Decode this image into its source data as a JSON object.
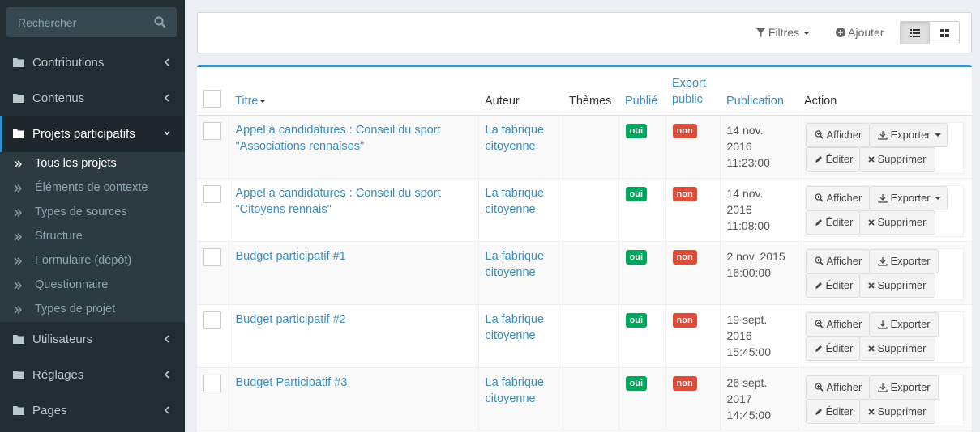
{
  "search": {
    "placeholder": "Rechercher"
  },
  "sidebar": {
    "items": [
      {
        "label": "Contributions"
      },
      {
        "label": "Contenus"
      },
      {
        "label": "Projets participatifs"
      },
      {
        "label": "Utilisateurs"
      },
      {
        "label": "Réglages"
      },
      {
        "label": "Pages"
      }
    ],
    "subitems": [
      {
        "label": "Tous les projets"
      },
      {
        "label": "Éléments de contexte"
      },
      {
        "label": "Types de sources"
      },
      {
        "label": "Structure"
      },
      {
        "label": "Formulaire (dépôt)"
      },
      {
        "label": "Questionnaire"
      },
      {
        "label": "Types de projet"
      }
    ]
  },
  "toolbar": {
    "filters": "Filtres",
    "add": "Ajouter"
  },
  "table": {
    "headers": {
      "title": "Titre",
      "author": "Auteur",
      "themes": "Thèmes",
      "published": "Publié",
      "export_line1": "Export",
      "export_line2": "public",
      "publication": "Publication",
      "action": "Action"
    },
    "actions": {
      "view": "Afficher",
      "export": "Exporter",
      "edit": "Éditer",
      "delete": "Supprimer"
    },
    "rows": [
      {
        "title_line1": "Appel à candidatures : Conseil du sport",
        "title_line2": "\"Associations rennaises\"",
        "author_line1": "La fabrique",
        "author_line2": "citoyenne",
        "published": "oui",
        "export": "non",
        "date_line1": "14 nov.",
        "date_line2": "2016",
        "date_line3": "11:23:00"
      },
      {
        "title_line1": "Appel à candidatures : Conseil du sport",
        "title_line2": "\"Citoyens rennais\"",
        "author_line1": "La fabrique",
        "author_line2": "citoyenne",
        "published": "oui",
        "export": "non",
        "date_line1": "14 nov.",
        "date_line2": "2016",
        "date_line3": "11:08:00"
      },
      {
        "title_line1": "Budget participatif #1",
        "title_line2": "",
        "author_line1": "La fabrique",
        "author_line2": "citoyenne",
        "published": "oui",
        "export": "non",
        "date_line1": "2 nov. 2015",
        "date_line2": "16:00:00",
        "date_line3": ""
      },
      {
        "title_line1": "Budget participatif #2",
        "title_line2": "",
        "author_line1": "La fabrique",
        "author_line2": "citoyenne",
        "published": "oui",
        "export": "non",
        "date_line1": "19 sept.",
        "date_line2": "2016",
        "date_line3": "15:45:00"
      },
      {
        "title_line1": "Budget Participatif #3",
        "title_line2": "",
        "author_line1": "La fabrique",
        "author_line2": "citoyenne",
        "published": "oui",
        "export": "non",
        "date_line1": "26 sept.",
        "date_line2": "2017",
        "date_line3": "14:45:00"
      }
    ]
  }
}
